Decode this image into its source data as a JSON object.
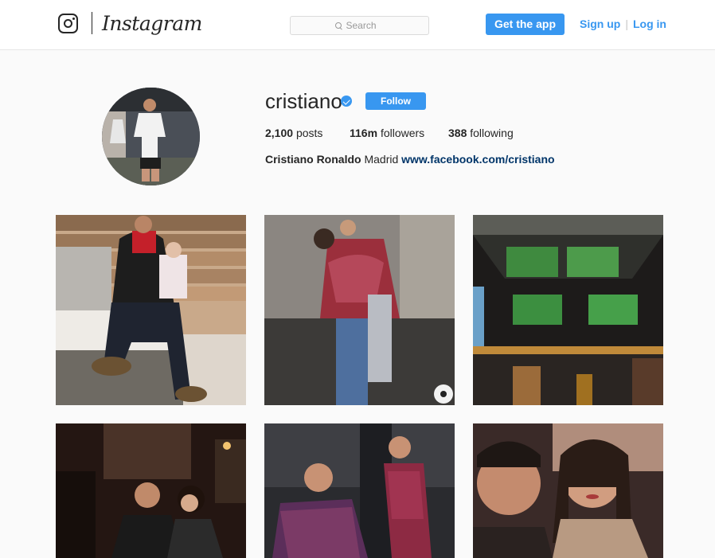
{
  "header": {
    "brand": "Instagram",
    "search": {
      "placeholder": "Search",
      "icon": "search-icon"
    },
    "get_app_label": "Get the app",
    "sign_up_label": "Sign up",
    "separator": "|",
    "log_in_label": "Log in",
    "accent_color": "#3897f0"
  },
  "profile": {
    "username": "cristiano",
    "verified": true,
    "follow_label": "Follow",
    "stats": {
      "posts": {
        "value": "2,100",
        "label": "posts"
      },
      "followers": {
        "value": "116m",
        "label": "followers"
      },
      "following": {
        "value": "388",
        "label": "following"
      }
    },
    "bio": {
      "full_name": "Cristiano Ronaldo",
      "text": "Madrid",
      "link": "www.facebook.com/cristiano"
    }
  },
  "posts": [
    {
      "scene": "man in red hoodie holding baby on wooden bench"
    },
    {
      "scene": "man in plaid shirt hugging child"
    },
    {
      "scene": "sports bar with screens"
    },
    {
      "scene": "couple at restaurant"
    },
    {
      "scene": "man adjusting child's shirt"
    },
    {
      "scene": "couple selfie"
    }
  ]
}
